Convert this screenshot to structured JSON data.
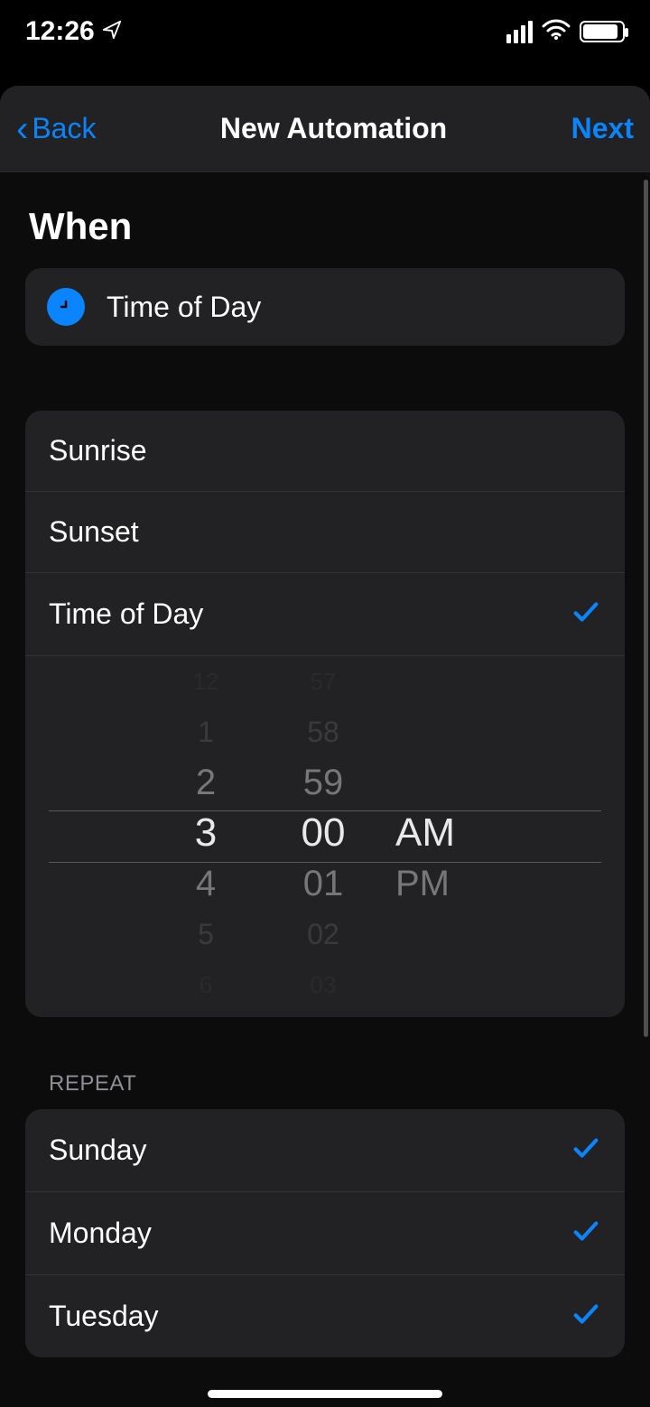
{
  "status": {
    "time": "12:26",
    "icons": {
      "location": "location-arrow",
      "cellular": "cellular-4-bars",
      "wifi": "wifi-icon",
      "battery": "battery-full"
    }
  },
  "nav": {
    "back_label": "Back",
    "title": "New Automation",
    "next_label": "Next"
  },
  "when": {
    "header": "When",
    "current": {
      "icon": "clock-icon",
      "label": "Time of Day"
    },
    "options": {
      "sunrise": {
        "label": "Sunrise",
        "selected": false
      },
      "sunset": {
        "label": "Sunset",
        "selected": false
      },
      "time_of_day": {
        "label": "Time of Day",
        "selected": true
      }
    },
    "time_picker": {
      "hours": {
        "faint_a": "12",
        "far_a": "1",
        "near_a": "2",
        "selected": "3",
        "near_b": "4",
        "far_b": "5",
        "faint_b": "6"
      },
      "minutes": {
        "faint_a": "57",
        "far_a": "58",
        "near_a": "59",
        "selected": "00",
        "near_b": "01",
        "far_b": "02",
        "faint_b": "03"
      },
      "ampm": {
        "selected": "AM",
        "other": "PM"
      }
    }
  },
  "repeat": {
    "header": "REPEAT",
    "days": {
      "sunday": {
        "label": "Sunday",
        "selected": true
      },
      "monday": {
        "label": "Monday",
        "selected": true
      },
      "tuesday": {
        "label": "Tuesday",
        "selected": true
      }
    }
  },
  "colors": {
    "accent": "#0a84ff",
    "card": "#222224",
    "sheet": "#1c1c1e",
    "bg": "#000000"
  }
}
